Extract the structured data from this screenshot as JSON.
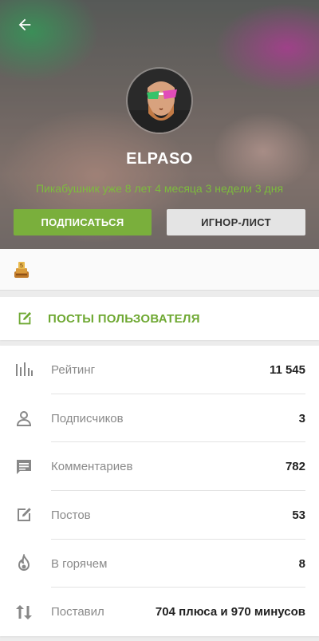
{
  "profile": {
    "username": "ELPASO",
    "tenure": "Пикабушник уже 8 лет 4 месяца 3 недели 3 дня",
    "subscribe_label": "ПОДПИСАТЬСЯ",
    "ignore_label": "ИГНОР-ЛИСТ"
  },
  "posts_link": {
    "label": "ПОСТЫ ПОЛЬЗОВАТЕЛЯ"
  },
  "stats": [
    {
      "icon": "rating-bars-icon",
      "label": "Рейтинг",
      "value": "11 545"
    },
    {
      "icon": "person-icon",
      "label": "Подписчиков",
      "value": "3"
    },
    {
      "icon": "comment-icon",
      "label": "Комментариев",
      "value": "782"
    },
    {
      "icon": "edit-post-icon",
      "label": "Постов",
      "value": "53"
    },
    {
      "icon": "flame-icon",
      "label": "В горячем",
      "value": "8"
    },
    {
      "icon": "up-down-arrows-icon",
      "label": "Поставил",
      "value": "704 плюса и 970 минусов"
    }
  ],
  "colors": {
    "accent": "#7aaf3c",
    "tenure_text": "#7dbb3d",
    "ignore_button": "#e4e4e4"
  }
}
